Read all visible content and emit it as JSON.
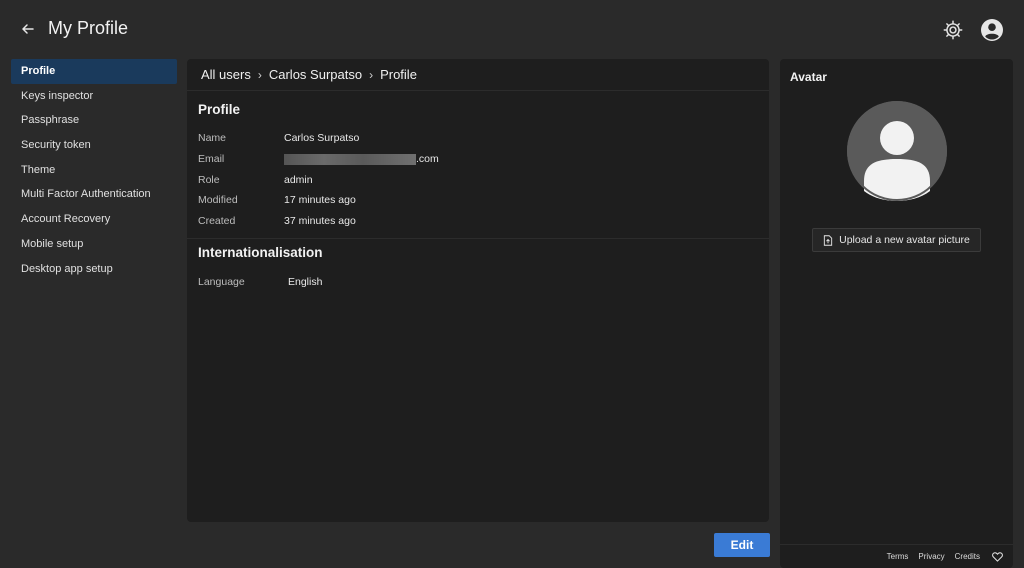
{
  "header": {
    "title": "My Profile",
    "back_icon": "arrow-left-icon",
    "settings_icon": "gear-icon",
    "user_icon": "user-circle-icon"
  },
  "sidebar": {
    "items": [
      {
        "label": "Profile",
        "active": true
      },
      {
        "label": "Keys inspector"
      },
      {
        "label": "Passphrase"
      },
      {
        "label": "Security token"
      },
      {
        "label": "Theme"
      },
      {
        "label": "Multi Factor Authentication"
      },
      {
        "label": "Account Recovery"
      },
      {
        "label": "Mobile setup"
      },
      {
        "label": "Desktop app setup"
      }
    ]
  },
  "breadcrumb": {
    "items": [
      "All users",
      "Carlos Surpatso",
      "Profile"
    ],
    "separator": "›"
  },
  "profile": {
    "title": "Profile",
    "fields": [
      {
        "label": "Name",
        "value": "Carlos Surpatso"
      },
      {
        "label": "Email",
        "value": ".com"
      },
      {
        "label": "Role",
        "value": "admin"
      },
      {
        "label": "Modified",
        "value": "17 minutes ago"
      },
      {
        "label": "Created",
        "value": "37 minutes ago"
      }
    ]
  },
  "internationalisation": {
    "title": "Internationalisation",
    "language_label": "Language",
    "language_value": "English"
  },
  "actions": {
    "edit_label": "Edit"
  },
  "avatar": {
    "title": "Avatar",
    "upload_label": "Upload a new avatar picture",
    "upload_icon": "file-upload-icon"
  },
  "footer": {
    "links": [
      "Terms",
      "Privacy",
      "Credits"
    ],
    "heart_icon": "heart-icon"
  },
  "colors": {
    "background": "#2a2a2a",
    "panel": "#1e1e1e",
    "active_nav": "#1a3a5c",
    "primary_button": "#3a7bd5"
  }
}
